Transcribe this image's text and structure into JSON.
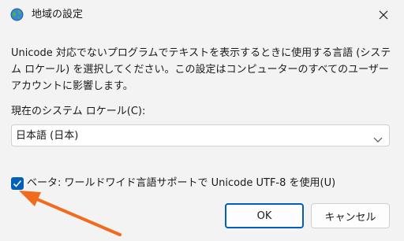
{
  "window": {
    "title": "地域の設定",
    "icon": "globe-icon",
    "close_icon": "close-icon"
  },
  "content": {
    "description": "Unicode 対応でないプログラムでテキストを表示するときに使用する言語 (システム ロケール) を選択してください。この設定はコンピューターのすべてのユーザー アカウントに影響します。",
    "locale_label": "現在のシステム ロケール(C):",
    "locale_selected": "日本語 (日本)",
    "beta_checkbox_label": "ベータ: ワールドワイド言語サポートで Unicode UTF-8 を使用(U)",
    "beta_checked": true
  },
  "buttons": {
    "ok_label": "OK",
    "cancel_label": "キャンセル"
  },
  "annotation": {
    "arrow_color": "#f26b1d"
  },
  "colors": {
    "accent": "#005fb8",
    "background": "#f3f3f3"
  }
}
